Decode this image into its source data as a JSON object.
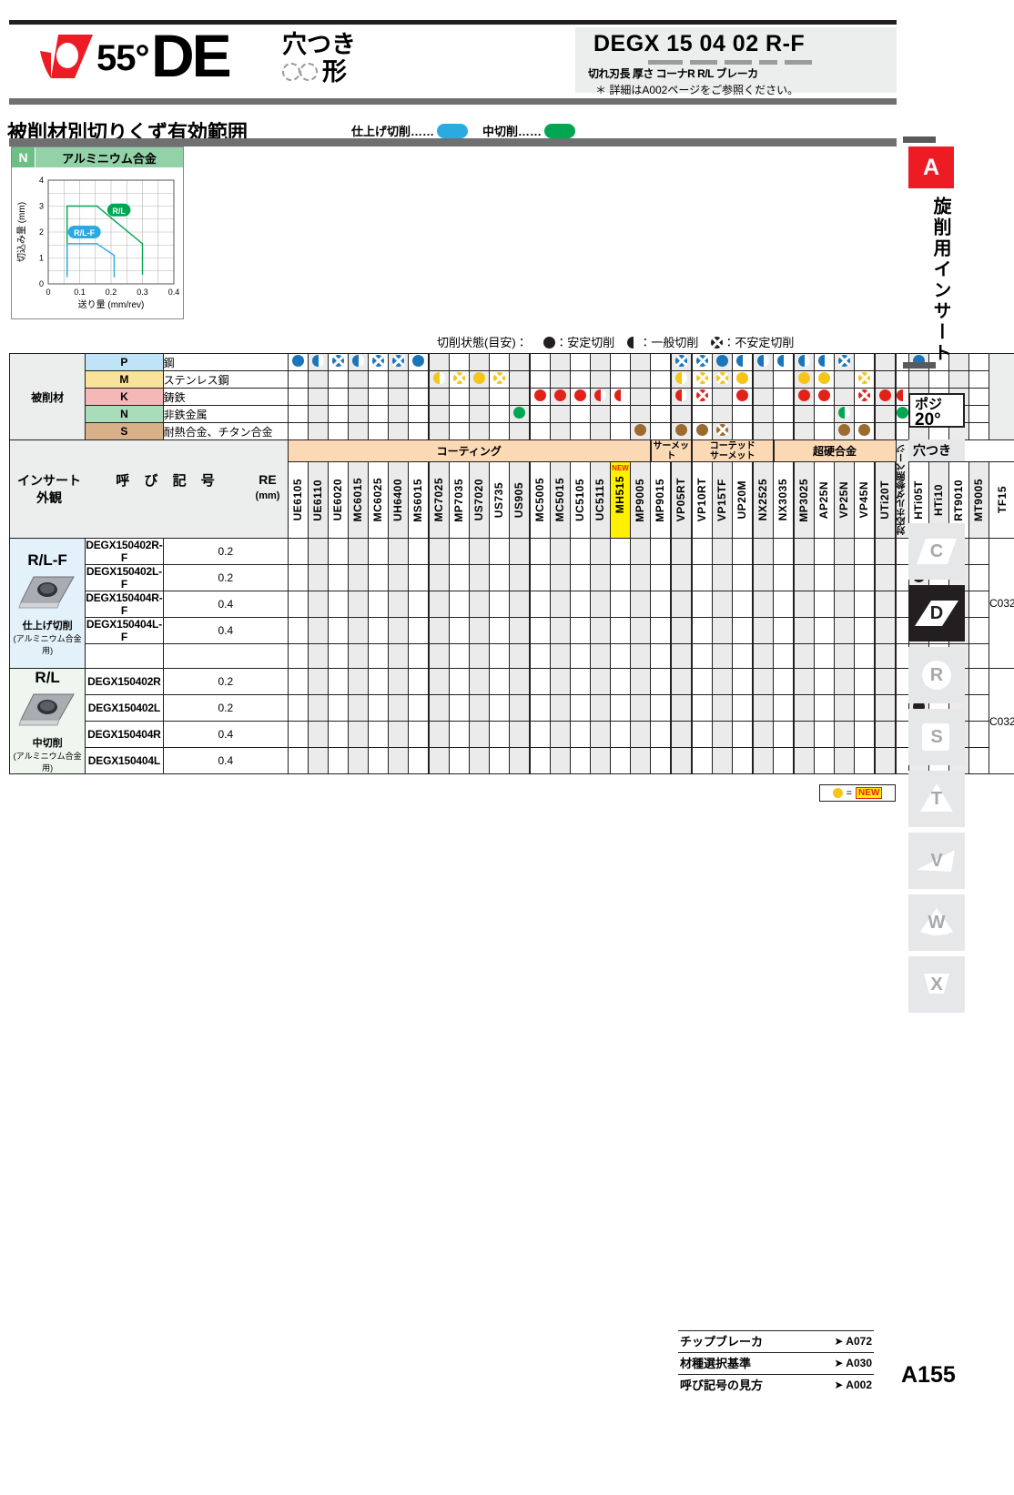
{
  "header": {
    "angle": "55°",
    "shape_code": "DE",
    "shape_sub_line1": "穴つき",
    "shape_sub_line2": "形",
    "code_title": "DEGX   15 04 02 R-F",
    "code_legend": "切れ刃長    厚さ  コーナR  R/L  ブレーカ",
    "code_note": "＊ 詳細はA002ページをご参照ください。"
  },
  "section": {
    "title": "被削材別切りくず有効範囲",
    "legend_finish": "仕上げ切削……",
    "legend_medium": "中切削……"
  },
  "chart_data": {
    "type": "area",
    "title": "アルミニウム合金",
    "group_code": "N",
    "xlabel": "送り量 (mm/rev)",
    "ylabel": "切込み量 (mm)",
    "xlim": [
      0,
      0.4
    ],
    "ylim": [
      0,
      4
    ],
    "xticks": [
      "0",
      "0.1",
      "0.2",
      "0.3",
      "0.4"
    ],
    "yticks": [
      "0",
      "1",
      "2",
      "3",
      "4"
    ],
    "grid": true,
    "series": [
      {
        "name": "R/L",
        "color": "#00a651",
        "label_pos": [
          0.225,
          2.85
        ],
        "polygon": [
          [
            0.06,
            0.35
          ],
          [
            0.06,
            3.0
          ],
          [
            0.155,
            3.0
          ],
          [
            0.3,
            1.55
          ],
          [
            0.3,
            0.35
          ]
        ]
      },
      {
        "name": "R/L-F",
        "color": "#29abe2",
        "label_pos": [
          0.115,
          2.0
        ],
        "polygon": [
          [
            0.06,
            0.25
          ],
          [
            0.06,
            1.55
          ],
          [
            0.155,
            1.55
          ],
          [
            0.21,
            1.1
          ],
          [
            0.21,
            0.25
          ]
        ]
      }
    ]
  },
  "cutting_state": {
    "prefix": "切削状態(目安)：",
    "items": [
      {
        "symbol": "full",
        "label": "：安定切削"
      },
      {
        "symbol": "half",
        "label": "：一般切削"
      },
      {
        "symbol": "cross",
        "label": "：不安定切削"
      }
    ]
  },
  "workpiece": {
    "row_label": "被削材",
    "rows": [
      {
        "code": "P",
        "name": "鋼",
        "color": "#bfe3f7",
        "dot_color": "#1b75bb"
      },
      {
        "code": "M",
        "name": "ステンレス鋼",
        "color": "#f9e39a",
        "dot_color": "#f5c518"
      },
      {
        "code": "K",
        "name": "鋳鉄",
        "color": "#f5b7b7",
        "dot_color": "#e32119"
      },
      {
        "code": "N",
        "name": "非鉄金属",
        "color": "#a9dcb9",
        "dot_color": "#00a651"
      },
      {
        "code": "S",
        "name": "耐熱合金、チタン合金",
        "color": "#d9b189",
        "dot_color": "#9c6b2f"
      }
    ]
  },
  "grade_groups": [
    {
      "label": "コーティング",
      "span": 18,
      "short": false
    },
    {
      "label": "サーメット",
      "span": 2,
      "short": true
    },
    {
      "label": "コーテッド\nサーメット",
      "span": 4,
      "short": true
    },
    {
      "label": "超硬合金",
      "span": 6,
      "short": false
    }
  ],
  "grades": [
    {
      "name": "UE6105",
      "new": false
    },
    {
      "name": "UE6110",
      "new": false
    },
    {
      "name": "UE6020",
      "new": false
    },
    {
      "name": "MC6015",
      "new": false
    },
    {
      "name": "MC6025",
      "new": false
    },
    {
      "name": "UH6400",
      "new": false
    },
    {
      "name": "MS6015",
      "new": false
    },
    {
      "name": "MC7025",
      "new": false
    },
    {
      "name": "MP7035",
      "new": false
    },
    {
      "name": "US7020",
      "new": false
    },
    {
      "name": "US735",
      "new": false
    },
    {
      "name": "US905",
      "new": false
    },
    {
      "name": "MC5005",
      "new": false
    },
    {
      "name": "MC5015",
      "new": false
    },
    {
      "name": "UC5105",
      "new": false
    },
    {
      "name": "UC5115",
      "new": false
    },
    {
      "name": "MH515",
      "new": true
    },
    {
      "name": "MP9005",
      "new": false
    },
    {
      "name": "MP9015",
      "new": false
    },
    {
      "name": "VP05RT",
      "new": false
    },
    {
      "name": "VP10RT",
      "new": false
    },
    {
      "name": "VP15TF",
      "new": false
    },
    {
      "name": "UP20M",
      "new": false
    },
    {
      "name": "NX2525",
      "new": false
    },
    {
      "name": "NX3035",
      "new": false
    },
    {
      "name": "MP3025",
      "new": false
    },
    {
      "name": "AP25N",
      "new": false
    },
    {
      "name": "VP25N",
      "new": false
    },
    {
      "name": "VP45N",
      "new": false
    },
    {
      "name": "UTi20T",
      "new": false
    },
    {
      "name": "HTi05T",
      "new": false
    },
    {
      "name": "HTi10",
      "new": false
    },
    {
      "name": "RT9010",
      "new": false
    },
    {
      "name": "MT9005",
      "new": false
    },
    {
      "name": "TF15",
      "new": false
    }
  ],
  "group_boundaries": [
    6,
    11,
    18,
    19,
    22,
    24,
    28,
    29
  ],
  "material_marks": {
    "P": {
      "0": "full",
      "1": "half",
      "2": "cross",
      "3": "half",
      "4": "cross",
      "5": "cross",
      "6": "full",
      "19": "cross",
      "20": "cross",
      "21": "full",
      "22": "half",
      "23": "half",
      "24": "half",
      "25": "half",
      "26": "half",
      "27": "cross",
      "31": "full"
    },
    "M": {
      "7": "half",
      "8": "cross",
      "9": "full",
      "10": "cross",
      "19": "half",
      "20": "cross",
      "21": "cross",
      "22": "full",
      "25": "full",
      "26": "full",
      "28": "cross"
    },
    "K": {
      "12": "full",
      "13": "full",
      "14": "full",
      "15": "half",
      "16": "half",
      "19": "half",
      "20": "cross",
      "22": "full",
      "25": "full",
      "26": "full",
      "28": "cross",
      "29": "full",
      "30": "half"
    },
    "N": {
      "11": "full",
      "27": "half",
      "30": "full"
    },
    "S": {
      "17": "full",
      "19": "full",
      "20": "full",
      "21": "cross",
      "27": "full",
      "28": "full"
    }
  },
  "table_headers": {
    "appearance": "インサート\n外観",
    "name": "呼 び 記 号",
    "re": "RE",
    "re_unit": "(mm)",
    "holder": "対応ホルダ\n参照ページ"
  },
  "groups": [
    {
      "shape_title": "R/L-F",
      "caption": "仕上げ切削",
      "caption2": "(アルミニウム合金用)",
      "bg": "#e3f1fa",
      "holder": "C032",
      "rows": [
        {
          "name": "DEGX150402R-F",
          "re": "0.2",
          "marks": {
            "31": "full"
          }
        },
        {
          "name": "DEGX150402L-F",
          "re": "0.2",
          "marks": {
            "31": "full"
          }
        },
        {
          "name": "DEGX150404R-F",
          "re": "0.4",
          "marks": {
            "31": "full"
          }
        },
        {
          "name": "DEGX150404L-F",
          "re": "0.4",
          "marks": {
            "31": "full"
          }
        },
        {
          "name": "",
          "re": "",
          "marks": {}
        }
      ]
    },
    {
      "shape_title": "R/L",
      "caption": "中切削",
      "caption2": "(アルミニウム合金用)",
      "bg": "#eef6ef",
      "holder": "C032",
      "rows": [
        {
          "name": "DEGX150402R",
          "re": "0.2",
          "marks": {
            "31": "full"
          }
        },
        {
          "name": "DEGX150402L",
          "re": "0.2",
          "marks": {
            "31": "full"
          }
        },
        {
          "name": "DEGX150404R",
          "re": "0.4",
          "marks": {
            "31": "full"
          }
        },
        {
          "name": "DEGX150404L",
          "re": "0.4",
          "marks": {
            "31": "full"
          }
        }
      ]
    }
  ],
  "new_note": {
    "equals": "=",
    "tag": "NEW"
  },
  "rail": {
    "section_letter": "A",
    "section_name": "旋削用インサート",
    "posi_line1": "ポジ",
    "posi_line2": "20°",
    "hole_label": "穴つき",
    "shapes": [
      {
        "label": "C",
        "active": false
      },
      {
        "label": "D",
        "active": true
      },
      {
        "label": "R",
        "active": false
      },
      {
        "label": "S",
        "active": false
      },
      {
        "label": "T",
        "active": false
      },
      {
        "label": "V",
        "active": false
      },
      {
        "label": "W",
        "active": false
      },
      {
        "label": "X",
        "active": false
      }
    ]
  },
  "footer": {
    "refs": [
      {
        "label": "チップブレーカ",
        "page": "A072"
      },
      {
        "label": "材種選択基準",
        "page": "A030"
      },
      {
        "label": "呼び記号の見方",
        "page": "A002"
      }
    ],
    "page_number": "A155"
  }
}
